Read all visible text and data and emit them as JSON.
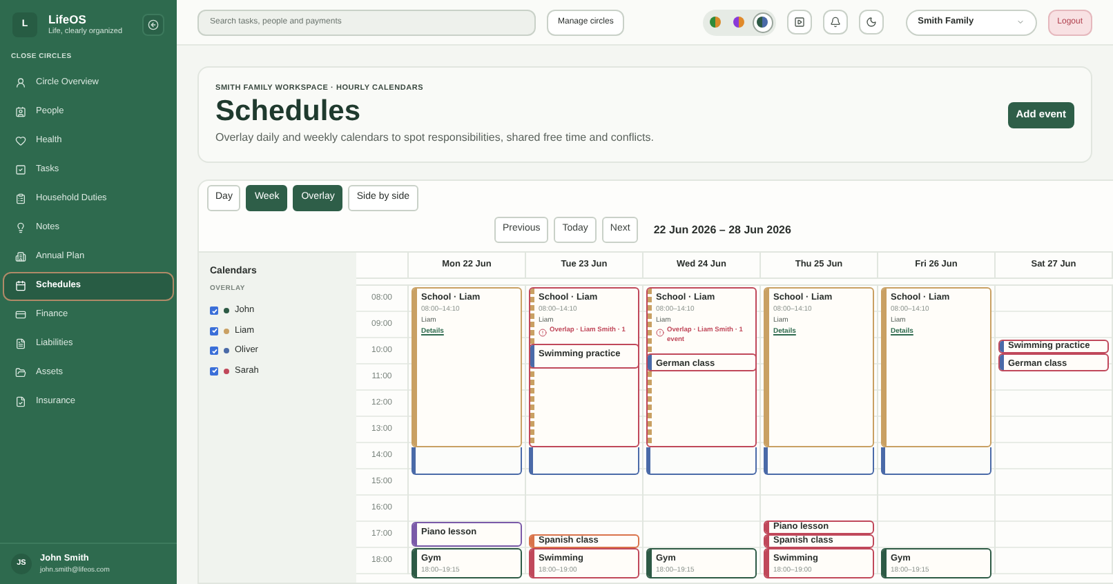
{
  "sidebar": {
    "brand": {
      "initial": "L",
      "name": "LifeOS",
      "tagline": "Life, clearly organized"
    },
    "section": "CLOSE CIRCLES",
    "items": [
      {
        "label": "Circle Overview",
        "selected": false
      },
      {
        "label": "People",
        "selected": false
      },
      {
        "label": "Health",
        "selected": false
      },
      {
        "label": "Tasks",
        "selected": false
      },
      {
        "label": "Household Duties",
        "selected": false
      },
      {
        "label": "Notes",
        "selected": false
      },
      {
        "label": "Annual Plan",
        "selected": false
      },
      {
        "label": "Schedules",
        "selected": true
      },
      {
        "label": "Finance",
        "selected": false
      },
      {
        "label": "Liabilities",
        "selected": false
      },
      {
        "label": "Assets",
        "selected": false
      },
      {
        "label": "Insurance",
        "selected": false
      }
    ],
    "user": {
      "initials": "JS",
      "name": "John Smith",
      "email": "john.smith@lifeos.com"
    }
  },
  "topbar": {
    "search": {
      "placeholder": "Search tasks, people and payments"
    },
    "manage": "Manage circles",
    "themes": [
      {
        "selected": false
      },
      {
        "selected": false
      },
      {
        "selected": true
      }
    ],
    "family": "Smith Family",
    "logout": "Logout"
  },
  "header": {
    "eyebrow": "SMITH FAMILY WORKSPACE · HOURLY CALENDARS",
    "title": "Schedules",
    "subtitle": "Overlay daily and weekly calendars to spot responsibilities, shared free time and conflicts.",
    "action": "Add event"
  },
  "views": [
    {
      "label": "Day",
      "selected": false
    },
    {
      "label": "Week",
      "selected": true
    },
    {
      "label": "Overlay",
      "selected": true
    },
    {
      "label": "Side by side",
      "selected": false
    }
  ],
  "nav": {
    "buttons": [
      "Previous",
      "Today",
      "Next"
    ],
    "range": "22 Jun 2026 – 28 Jun 2026"
  },
  "calendars": {
    "title": "Calendars",
    "subtitle": "OVERLAY",
    "people": [
      {
        "name": "John",
        "checked": true,
        "color": "#2d5a45"
      },
      {
        "name": "Liam",
        "checked": true,
        "color": "#c9a063"
      },
      {
        "name": "Oliver",
        "checked": true,
        "color": "#4a6aa8"
      },
      {
        "name": "Sarah",
        "checked": true,
        "color": "#c0485a"
      }
    ]
  },
  "hours": [
    "08:00",
    "09:00",
    "10:00",
    "11:00",
    "12:00",
    "13:00",
    "14:00",
    "15:00",
    "16:00",
    "17:00",
    "18:00"
  ],
  "days": [
    {
      "label": "Mon 22 Jun",
      "events": [
        {
          "kind": "block",
          "color": "#4a6aa8"
        },
        {
          "kind": "event",
          "title": "School · Liam",
          "time": "08:00–14:10",
          "person": "Liam",
          "link": "Details",
          "color": "#c9a063",
          "conflict": false
        },
        {
          "kind": "event",
          "title": "Piano lesson",
          "color": "#7a5aa8",
          "conflict": false
        },
        {
          "kind": "event",
          "title": "Gym",
          "time": "18:00–19:15",
          "color": "#2d5a45",
          "conflict": false
        }
      ]
    },
    {
      "label": "Tue 23 Jun",
      "events": [
        {
          "kind": "block",
          "color": "#4a6aa8"
        },
        {
          "kind": "event",
          "title": "School · Liam",
          "time": "08:00–14:10",
          "person": "Liam",
          "overlap": "Overlap · Liam Smith · 1",
          "color": "#c9a063",
          "conflict": true
        },
        {
          "kind": "event",
          "title": "Swimming practice",
          "color": "#4a6aa8",
          "conflict": true
        },
        {
          "kind": "event",
          "title": "Spanish class",
          "color": "#d9734a",
          "conflict": false
        },
        {
          "kind": "event",
          "title": "Swimming",
          "time": "18:00–19:00",
          "color": "#c0485a"
        }
      ]
    },
    {
      "label": "Wed 24 Jun",
      "events": [
        {
          "kind": "block",
          "color": "#4a6aa8"
        },
        {
          "kind": "event",
          "title": "School · Liam",
          "time": "08:00–14:10",
          "person": "Liam",
          "overlap": "Overlap · Liam Smith · 1 event",
          "color": "#c9a063",
          "conflict": true
        },
        {
          "kind": "event",
          "title": "German class",
          "color": "#4a6aa8",
          "conflict": true
        },
        {
          "kind": "event",
          "title": "Gym",
          "time": "18:00–19:15",
          "color": "#2d5a45",
          "conflict": false
        }
      ]
    },
    {
      "label": "Thu 25 Jun",
      "events": [
        {
          "kind": "block",
          "color": "#4a6aa8"
        },
        {
          "kind": "event",
          "title": "School · Liam",
          "time": "08:00–14:10",
          "person": "Liam",
          "link": "Details",
          "color": "#c9a063",
          "conflict": false
        },
        {
          "kind": "event",
          "title": "Piano lesson",
          "color": "#c0485a"
        },
        {
          "kind": "event",
          "title": "Spanish class",
          "color": "#c0485a"
        },
        {
          "kind": "event",
          "title": "Swimming",
          "time": "18:00–19:00",
          "color": "#c0485a"
        }
      ]
    },
    {
      "label": "Fri 26 Jun",
      "events": [
        {
          "kind": "block",
          "color": "#4a6aa8"
        },
        {
          "kind": "event",
          "title": "School · Liam",
          "time": "08:00–14:10",
          "person": "Liam",
          "link": "Details",
          "color": "#c9a063",
          "conflict": false
        },
        {
          "kind": "event",
          "title": "Gym",
          "time": "18:00–19:15",
          "color": "#2d5a45",
          "conflict": false
        }
      ]
    },
    {
      "label": "Sat 27 Jun",
      "events": [
        {
          "kind": "event",
          "title": "Swimming practice",
          "color": "#4a6aa8",
          "conflict": true
        },
        {
          "kind": "event",
          "title": "German class",
          "color": "#4a6aa8",
          "conflict": true
        }
      ]
    }
  ]
}
